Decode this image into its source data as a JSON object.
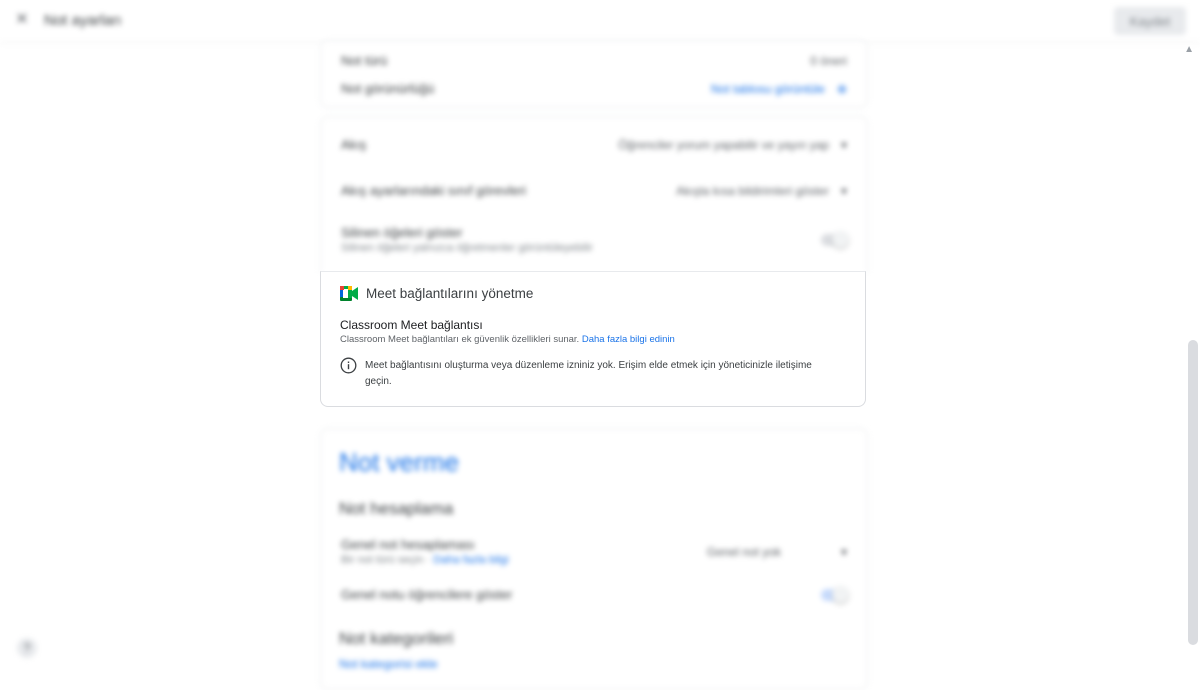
{
  "topbar": {
    "title": "Not ayarları",
    "save_label": "Kaydet"
  },
  "card_top": {
    "rows": [
      {
        "label": "Not türü",
        "value": "0 öneri"
      },
      {
        "label": "Not görünürlüğü",
        "value": "Not tablosu görüntüle"
      }
    ]
  },
  "card_settings": {
    "rows": [
      {
        "label": "Akış",
        "value": "Öğrenciler yorum yapabilir ve yayın yap"
      },
      {
        "label": "Akış ayarlarındaki sınıf görevleri",
        "value": "Akışta kısa bildirimleri göster"
      },
      {
        "label": "Silinen öğeleri göster",
        "sub": "Silinen öğeleri yalnızca öğretmenler görüntüleyebilir"
      }
    ]
  },
  "meet": {
    "title": "Meet bağlantılarını yönetme",
    "connection_title": "Classroom Meet bağlantısı",
    "connection_desc": "Classroom Meet bağlantıları ek güvenlik özellikleri sunar.",
    "learn_more": "Daha fazla bilgi edinin",
    "info_text": "Meet bağlantısını oluşturma veya düzenleme izniniz yok. Erişim elde etmek için yöneticinizle iletişime geçin."
  },
  "grading": {
    "heading": "Not verme",
    "section1": "Not hesaplama",
    "row1_label": "Genel not hesaplaması",
    "row1_sub": "Bir not türü seçin ·",
    "row1_link": "Daha fazla bilgi",
    "row1_value": "Genel not yok",
    "row2_label": "Genel notu öğrencilere göster",
    "section2": "Not kategorileri",
    "add_category": "Not kategorisi ekle"
  },
  "colors": {
    "accent": "#1a73e8",
    "meet_green": "#00832d",
    "meet_blue": "#0066da",
    "meet_yellow": "#ffba00",
    "meet_red": "#e94235"
  }
}
